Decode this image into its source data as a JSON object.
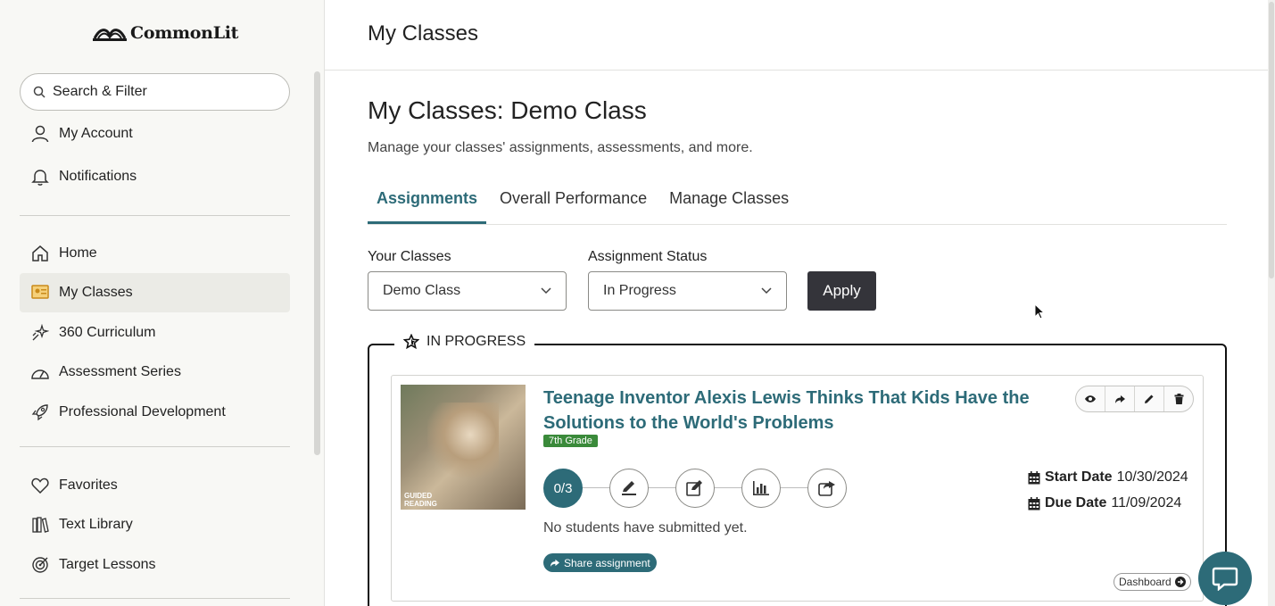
{
  "app": {
    "logo_text": "CommonLit"
  },
  "sidebar": {
    "search_label": "Search & Filter",
    "items": [
      {
        "label": "My Account",
        "icon": "user-icon"
      },
      {
        "label": "Notifications",
        "icon": "bell-icon"
      },
      {
        "label": "Home",
        "icon": "home-icon"
      },
      {
        "label": "My Classes",
        "icon": "classes-icon",
        "active": true
      },
      {
        "label": "360 Curriculum",
        "icon": "sparkle-icon"
      },
      {
        "label": "Assessment Series",
        "icon": "gauge-icon"
      },
      {
        "label": "Professional Development",
        "icon": "rocket-icon"
      },
      {
        "label": "Favorites",
        "icon": "heart-icon"
      },
      {
        "label": "Text Library",
        "icon": "books-icon"
      },
      {
        "label": "Target Lessons",
        "icon": "target-icon"
      }
    ]
  },
  "header": {
    "title": "My Classes"
  },
  "main": {
    "title": "My Classes: Demo Class",
    "subtitle": "Manage your classes' assignments, assessments, and more.",
    "tabs": [
      {
        "label": "Assignments",
        "active": true
      },
      {
        "label": "Overall Performance"
      },
      {
        "label": "Manage Classes"
      }
    ],
    "filters": {
      "classes_label": "Your Classes",
      "classes_value": "Demo Class",
      "status_label": "Assignment Status",
      "status_value": "In Progress",
      "apply_label": "Apply"
    },
    "section": {
      "label": "IN PROGRESS",
      "card": {
        "title": "Teenage Inventor Alexis Lewis Thinks That Kids Have the Solutions to the World's Problems",
        "thumb_label_1": "GUIDED",
        "thumb_label_2": "READING",
        "grade": "7th Grade",
        "progress": "0/3",
        "status": "No students have submitted yet.",
        "share_label": "Share assignment",
        "start_label": "Start Date",
        "start_value": "10/30/2024",
        "due_label": "Due Date",
        "due_value": "11/09/2024",
        "dashboard_label": "Dashboard"
      }
    }
  },
  "colors": {
    "accent": "#2d6b78",
    "grade_badge": "#3a8a3a",
    "apply_bg": "#34343a"
  }
}
